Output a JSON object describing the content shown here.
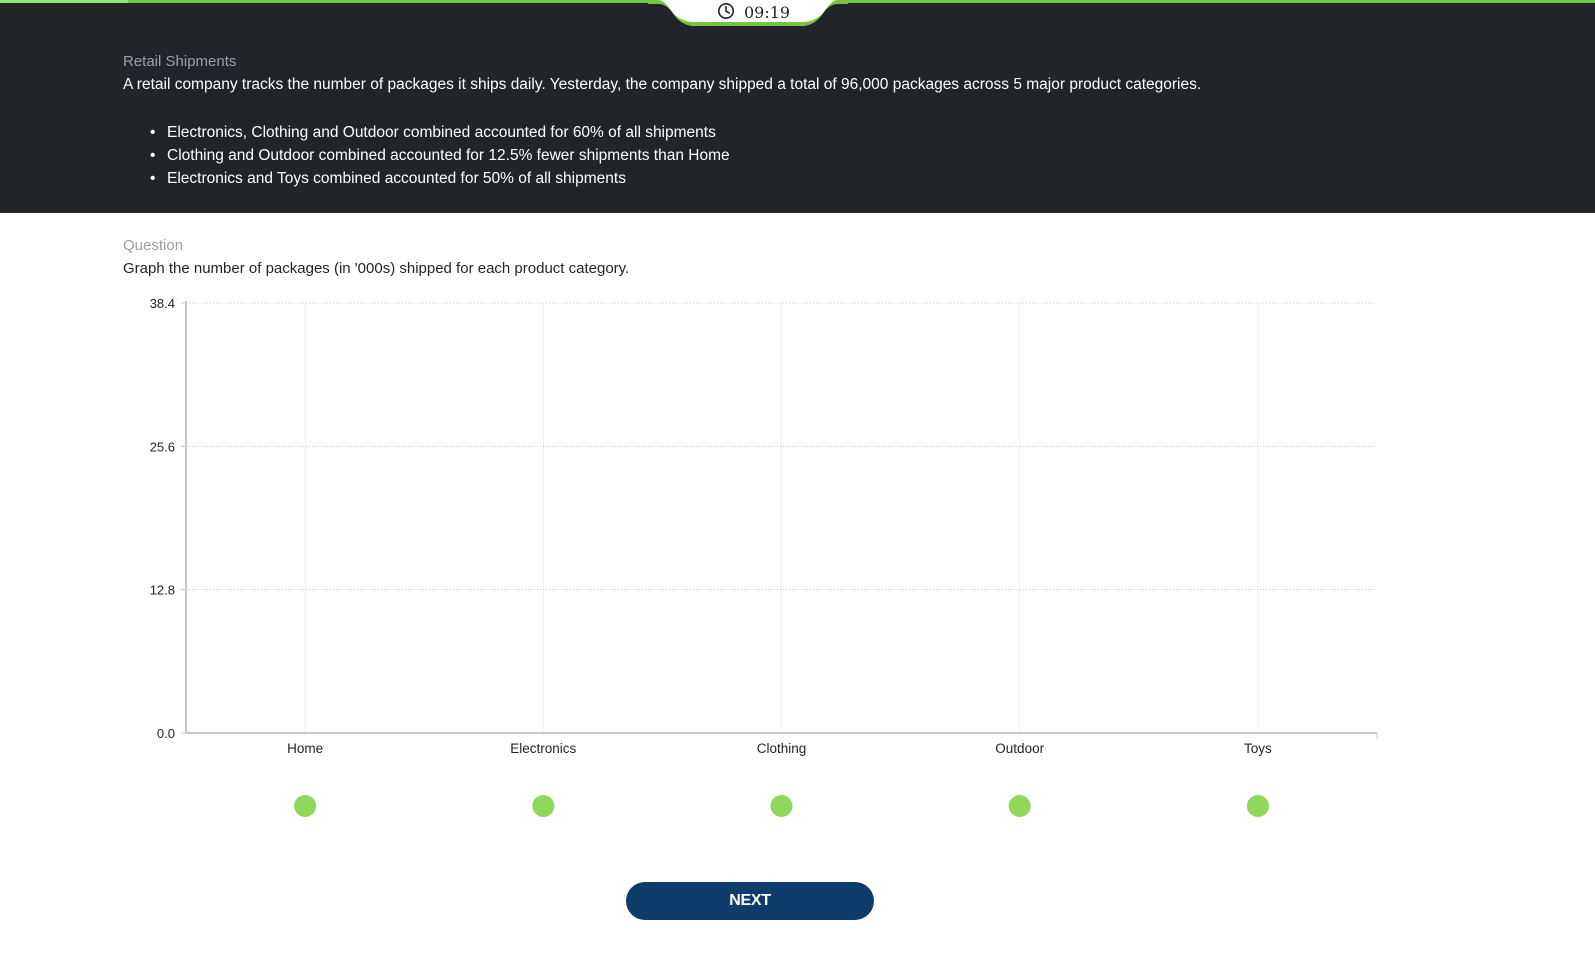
{
  "timer": {
    "value": "09:19",
    "icon": "clock-icon"
  },
  "progress": {
    "fraction": 0.08
  },
  "passage": {
    "label": "Retail Shipments",
    "intro": "A retail company tracks the number of packages it ships daily. Yesterday, the company shipped a total of 96,000 packages across 5 major product categories.",
    "bullets": [
      "Electronics, Clothing and Outdoor combined accounted for 60% of all shipments",
      "Clothing and Outdoor combined accounted for 12.5% fewer shipments than Home",
      "Electronics and Toys combined accounted for 50% of all shipments"
    ]
  },
  "question": {
    "label": "Question",
    "text": "Graph the number of packages (in '000s) shipped for each product category."
  },
  "chart_data": {
    "type": "bar",
    "categories": [
      "Home",
      "Electronics",
      "Clothing",
      "Outdoor",
      "Toys"
    ],
    "values": [
      0,
      0,
      0,
      0,
      0
    ],
    "ylim": [
      0,
      38.4
    ],
    "yticks": [
      "0.0",
      "12.8",
      "25.6",
      "38.4"
    ],
    "grid": true
  },
  "colors": {
    "accent": "#76c542",
    "handle": "#8fd85a",
    "header_bg": "#212529",
    "button_bg": "#0e3c6a"
  },
  "next_button": {
    "label": "NEXT"
  }
}
